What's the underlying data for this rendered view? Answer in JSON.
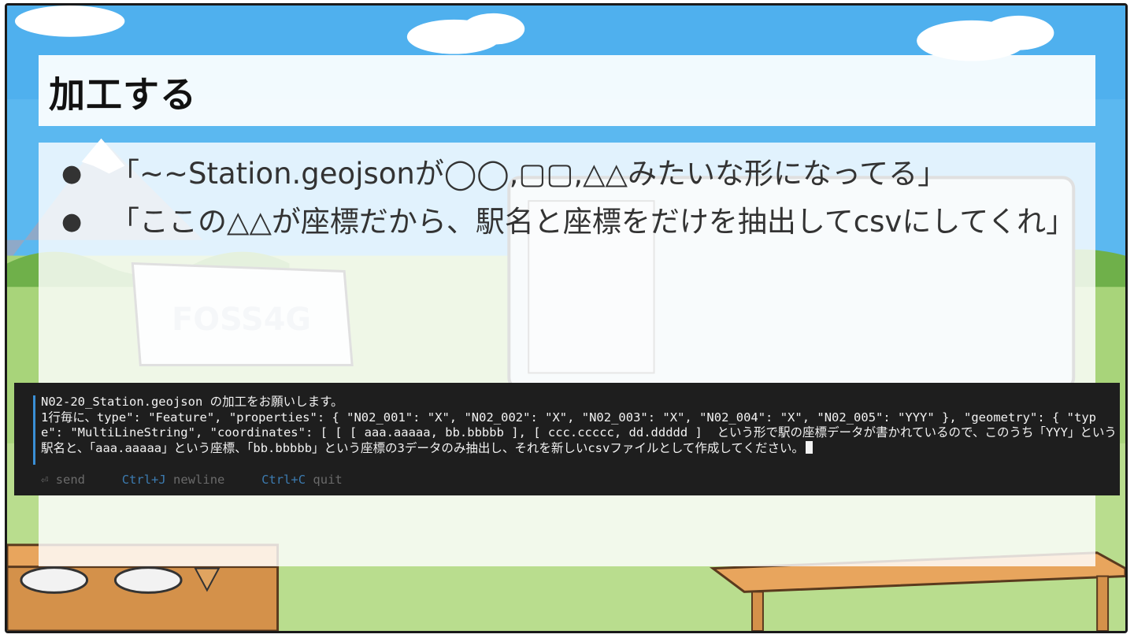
{
  "slide": {
    "title": "加工する",
    "bullets": [
      "「~~Station.geojsonが◯◯,▢▢,△△みたいな形になってる」",
      "「ここの△△が座標だから、駅名と座標をだけを抽出してcsvにしてくれ」"
    ],
    "background_sign": "FOSS4G"
  },
  "terminal": {
    "lines": [
      "N02-20_Station.geojson の加工をお願いします。",
      "1行毎に、type\": \"Feature\", \"properties\": { \"N02_001\": \"X\", \"N02_002\": \"X\", \"N02_003\": \"X\", \"N02_004\": \"X\", \"N02_005\": \"YYY\" }, \"geometry\": { \"type\": \"MultiLineString\", \"coordinates\": [ [ [ aaa.aaaaa, bb.bbbbb ], [ ccc.ccccc, dd.ddddd ]  という形で駅の座標データが書かれているので、このうち「YYY」という駅名と、「aaa.aaaaa」という座標、「bb.bbbbb」という座標の3データのみ抽出し、それを新しいcsvファイルとして作成してください。"
    ],
    "hints": {
      "send_icon": "⏎",
      "send": "send",
      "newline_key": "Ctrl+J",
      "newline": "newline",
      "quit_key": "Ctrl+C",
      "quit": "quit"
    }
  },
  "colors": {
    "sky": "#5bb8f0",
    "grass": "#9ccc65",
    "terminal_bg": "#1e1e1e",
    "terminal_accent": "#3a8fd6"
  }
}
